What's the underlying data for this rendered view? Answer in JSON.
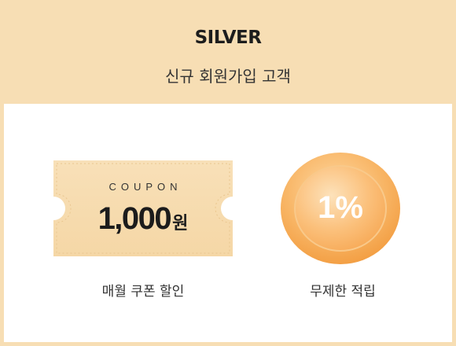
{
  "grade": {
    "name": "SILVER",
    "description": "신규 회원가입 고객"
  },
  "coupon": {
    "label": "COUPON",
    "amount": "1,000",
    "unit": "원",
    "caption": "매월 쿠폰 할인"
  },
  "points": {
    "rate": "1%",
    "caption": "무제한 적립"
  },
  "colors": {
    "header_bg": "#f7deb4",
    "ticket_bg": "#f7deb4",
    "coin_outer": "#f6b25e",
    "coin_inner": "#fbc27e"
  },
  "icons": {
    "coupon": "coupon-ticket-icon",
    "coin": "coin-icon"
  }
}
